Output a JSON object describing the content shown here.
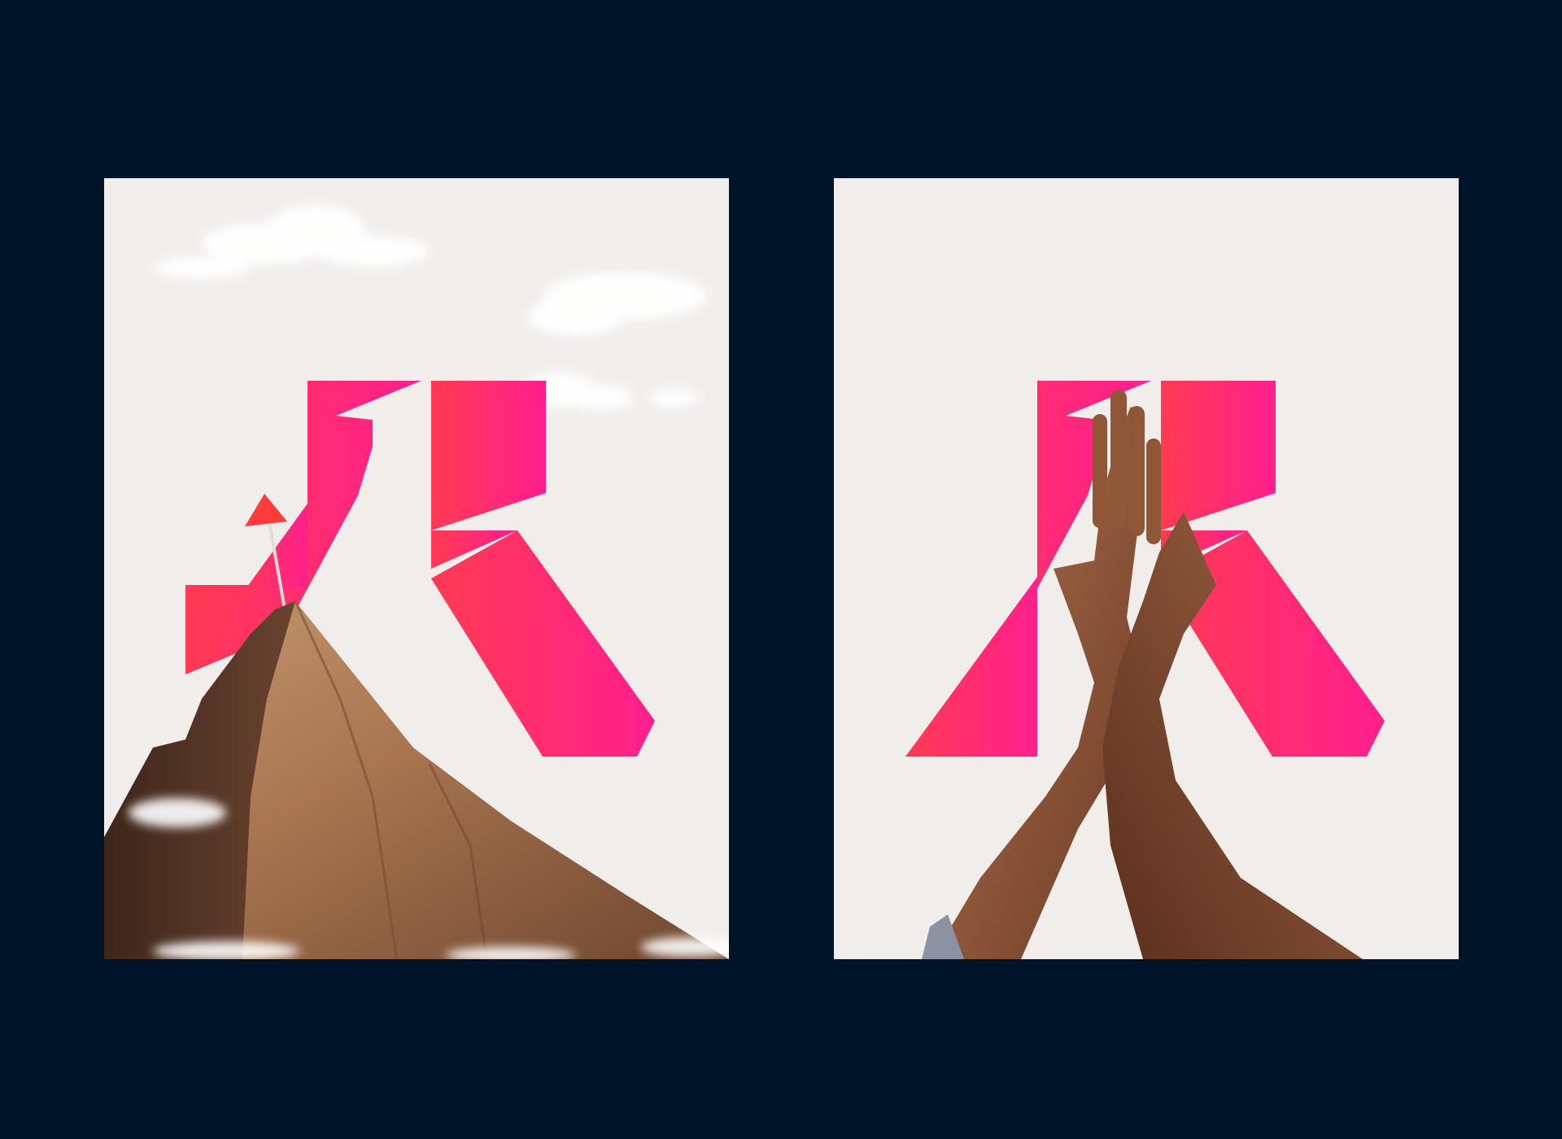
{
  "canvas": {
    "background": "#001429"
  },
  "panels": [
    {
      "id": "mountain-poster",
      "background": "#f0edeb",
      "subject": "mountain-peak-with-flag",
      "accent_gradient": [
        "#ff3a52",
        "#ff1f8e"
      ]
    },
    {
      "id": "high-five-poster",
      "background": "#f0edeb",
      "subject": "two-hands-high-five",
      "accent_gradient": [
        "#ff3a52",
        "#ff1f8e"
      ]
    }
  ],
  "icons": {
    "logo_mark": "stylized-letter-mark",
    "flag": "flag-icon"
  }
}
